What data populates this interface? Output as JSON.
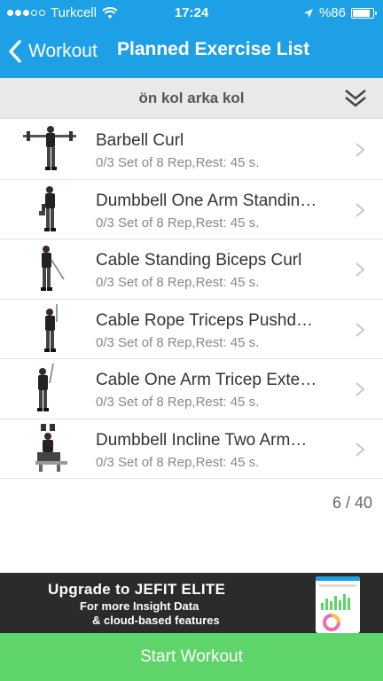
{
  "status_bar": {
    "carrier": "Turkcell",
    "time": "17:24",
    "battery_text": "%86",
    "battery_level": 0.86,
    "icons": [
      "signal-dots-icon",
      "wifi-icon",
      "location-arrow-icon",
      "battery-icon"
    ]
  },
  "nav": {
    "back_label": "Workout",
    "title": "Planned Exercise List"
  },
  "subheader": {
    "label": "ön kol arka kol",
    "expand_icon": "double-chevron-down-icon"
  },
  "exercises": [
    {
      "name": "Barbell Curl",
      "detail": "0/3 Set of 8 Rep,Rest: 45 s."
    },
    {
      "name": "Dumbbell One Arm Standin…",
      "detail": "0/3 Set of 8 Rep,Rest: 45 s."
    },
    {
      "name": "Cable Standing Biceps Curl",
      "detail": "0/3 Set of 8 Rep,Rest: 45 s."
    },
    {
      "name": "Cable Rope Triceps Pushd…",
      "detail": "0/3 Set of 8 Rep,Rest: 45 s."
    },
    {
      "name": "Cable One Arm Tricep Exte…",
      "detail": "0/3 Set of 8 Rep,Rest: 45 s."
    },
    {
      "name": "Dumbbell Incline Two Arm…",
      "detail": "0/3 Set of 8 Rep,Rest: 45 s."
    }
  ],
  "page_count": "6 / 40",
  "ad": {
    "line1": "Upgrade to JEFIT ELITE",
    "line2": "For more Insight Data",
    "line3": "& cloud-based features"
  },
  "start_button": "Start Workout",
  "colors": {
    "nav_blue": "#1ea0e6",
    "start_green": "#5ed46a",
    "ad_dark": "#2b2b2b"
  }
}
